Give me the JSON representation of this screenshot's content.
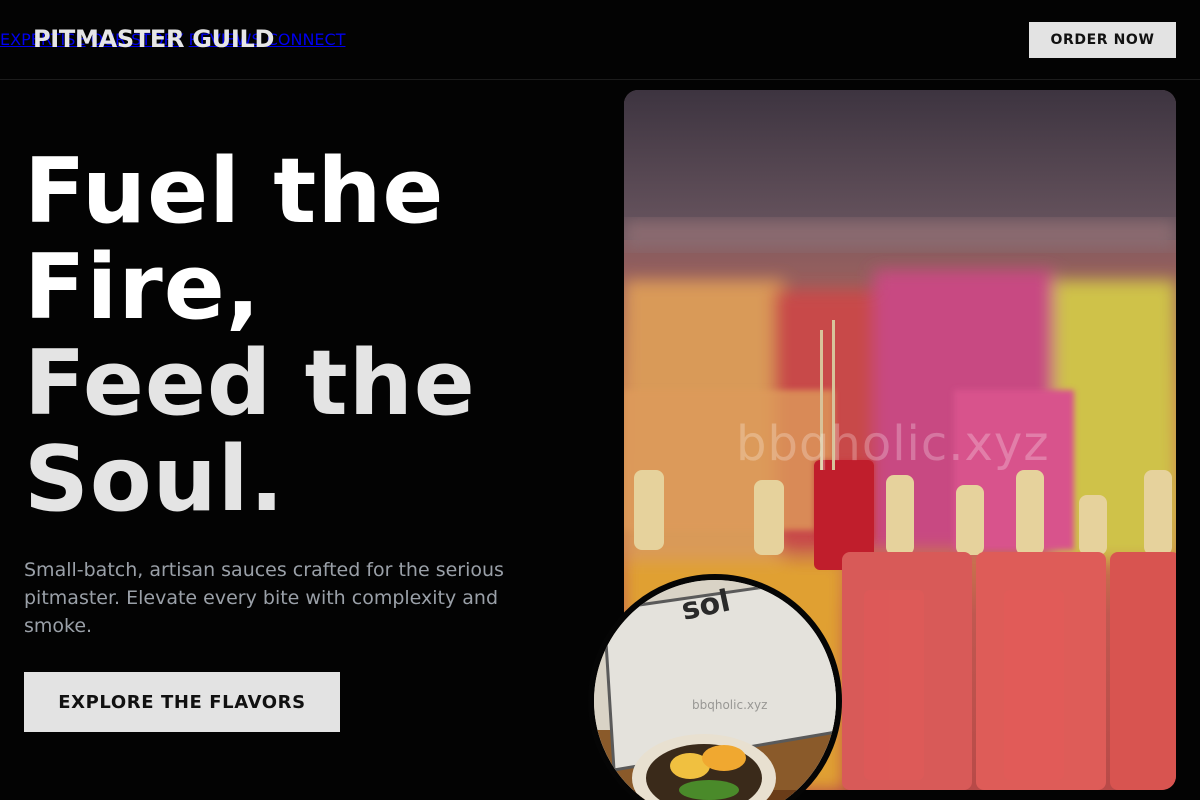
{
  "header": {
    "brand": "PITMASTER GUILD",
    "nav": [
      "EXPERTISE",
      "OUR STORY",
      "REVIEWS",
      "CONNECT"
    ],
    "cta_label": "ORDER NOW"
  },
  "hero": {
    "headline_lines": [
      "Fuel the",
      "Fire,",
      "Feed the",
      "Soul."
    ],
    "subcopy": "Small-batch, artisan sauces crafted for the serious pitmaster. Elevate every bite with complexity and smoke.",
    "cta_label": "EXPLORE THE FLAVORS"
  },
  "images": {
    "main_watermark": "bbqholic.xyz",
    "inset_watermark": "bbqholic.xyz"
  },
  "colors": {
    "background": "#030303",
    "button_bg": "#e3e3e3",
    "headline_primary": "#ffffff",
    "headline_secondary": "#e4e4e4",
    "subcopy": "#9aa0a8"
  }
}
